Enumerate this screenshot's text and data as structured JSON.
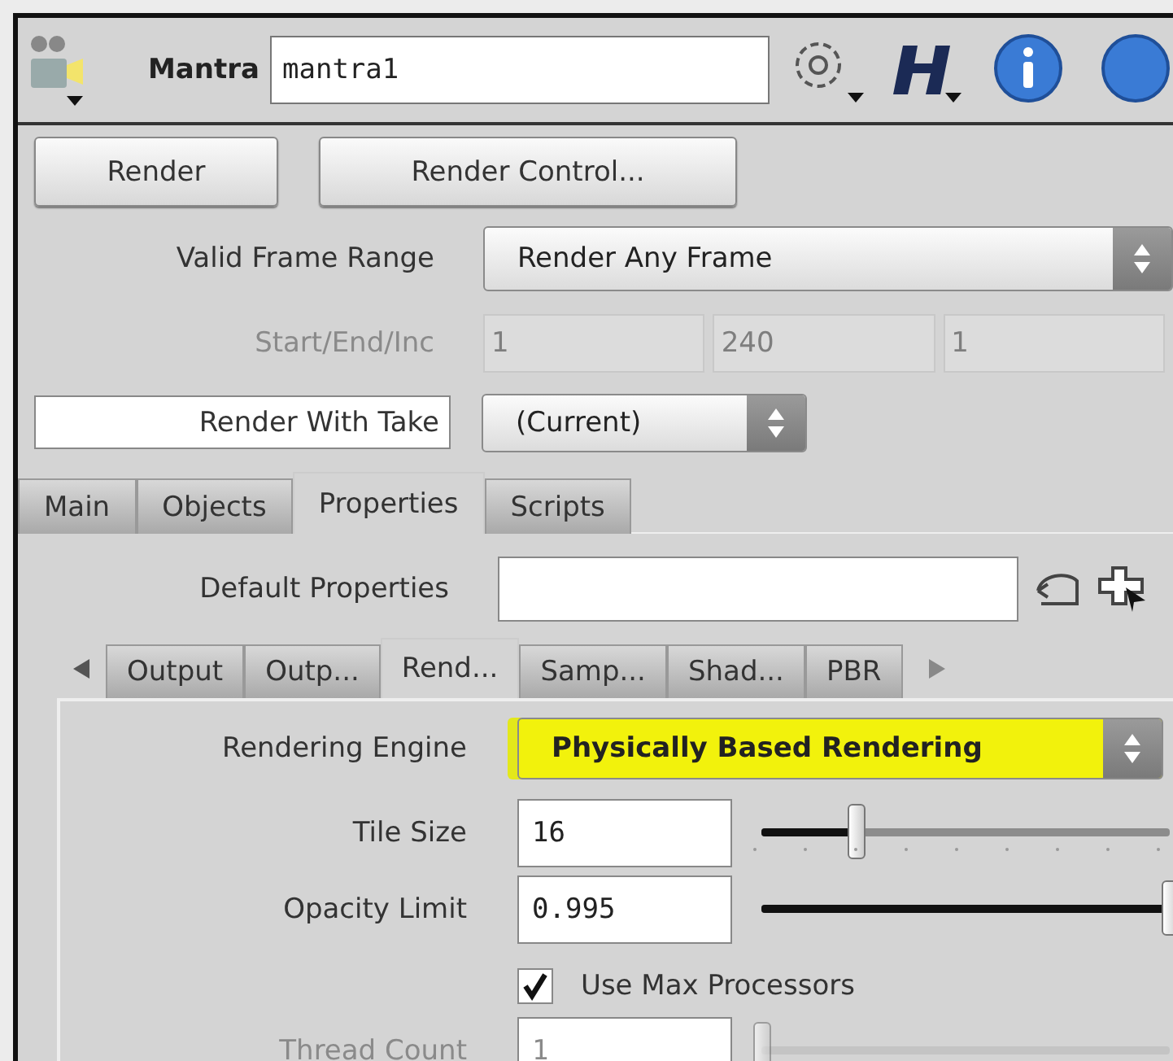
{
  "node": {
    "type_label": "Mantra",
    "name": "mantra1"
  },
  "buttons": [
    {
      "label": "Render"
    },
    {
      "label": "Render Control..."
    }
  ],
  "valid_frame_range": {
    "label": "Valid Frame Range",
    "value": "Render Any Frame"
  },
  "start_end_inc": {
    "label": "Start/End/Inc",
    "values": [
      "1",
      "240",
      "1"
    ],
    "disabled": true
  },
  "render_with_take": {
    "label": "Render With Take",
    "value": "(Current)"
  },
  "tabs": [
    {
      "label": "Main",
      "selected": false
    },
    {
      "label": "Objects",
      "selected": false
    },
    {
      "label": "Properties",
      "selected": true
    },
    {
      "label": "Scripts",
      "selected": false
    }
  ],
  "default_properties": {
    "label": "Default Properties"
  },
  "subtabs": [
    {
      "label": "Output",
      "selected": false
    },
    {
      "label": "Outp...",
      "selected": false
    },
    {
      "label": "Rend...",
      "selected": true
    },
    {
      "label": "Samp...",
      "selected": false
    },
    {
      "label": "Shad...",
      "selected": false
    },
    {
      "label": "PBR",
      "selected": false
    }
  ],
  "params": [
    {
      "kind": "dropdown",
      "label": "Rendering Engine",
      "value": "Physically Based Rendering",
      "highlighted": true,
      "disabled": false
    },
    {
      "kind": "slider",
      "label": "Tile Size",
      "value": "16",
      "level": 0.23,
      "disabled": false
    },
    {
      "kind": "slider",
      "label": "Opacity Limit",
      "value": "0.995",
      "level": 1,
      "disabled": false
    },
    {
      "kind": "checkbox",
      "label": "Use Max Processors",
      "checked": true,
      "disabled": false
    },
    {
      "kind": "slider",
      "label": "Thread Count",
      "value": "1",
      "level": 0,
      "disabled": true
    }
  ]
}
